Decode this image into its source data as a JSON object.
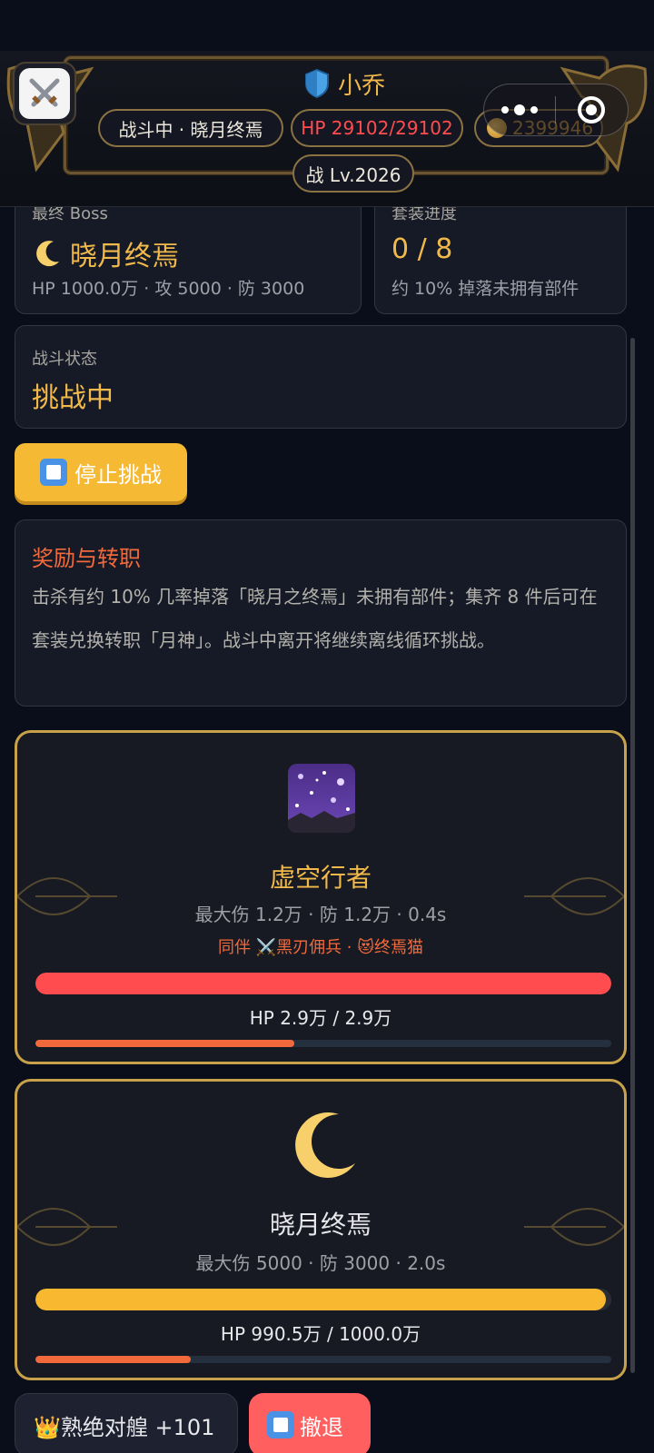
{
  "header": {
    "player_name": "小乔",
    "status": "战斗中 · 晓月终焉",
    "hp": "HP 29102/29102",
    "gold": "2399946",
    "level": "战 Lv.2026"
  },
  "boss_card": {
    "label": "最终 Boss",
    "name": "晓月终焉",
    "stats": "HP 1000.0万 · 攻 5000 · 防 3000"
  },
  "set_card": {
    "label": "套装进度",
    "value": "0 / 8",
    "note": "约 10% 掉落未拥有部件"
  },
  "battle_state": {
    "label": "战斗状态",
    "value": "挑战中"
  },
  "stop_button": "停止挑战",
  "reward": {
    "title": "奖励与转职",
    "body": "击杀有约 10% 几率掉落「晓月之终焉」未拥有部件；集齐 8 件后可在套装兑换转职「月神」。战斗中离开将继续离线循环挑战。"
  },
  "player_fighter": {
    "name": "虚空行者",
    "stats": "最大伤 1.2万 · 防 1.2万 · 0.4s",
    "companion": "同伴 ⚔️黑刃佣兵 · 😻终焉猫",
    "hp_text": "HP 2.9万 / 2.9万",
    "hp_fraction": 1.0,
    "attack_progress": 0.45,
    "hp_color": "#ff4d4f"
  },
  "boss_fighter": {
    "name": "晓月终焉",
    "stats": "最大伤 5000 · 防 3000 · 2.0s",
    "hp_text": "HP 990.5万 / 1000.0万",
    "hp_fraction": 0.9905,
    "attack_progress": 0.27,
    "hp_color": "#f8b931"
  },
  "bottom": {
    "skill_label": "👑熟绝对艎 +101",
    "retreat_label": "撤退"
  },
  "colors": {
    "accent_gold": "#f1b94a",
    "accent_orange": "#f26a3b",
    "danger_red": "#ff4d4f"
  }
}
